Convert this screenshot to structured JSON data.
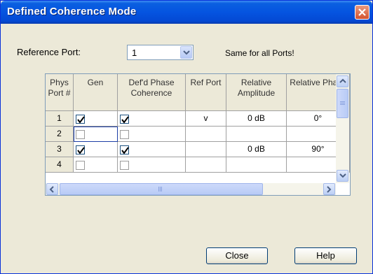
{
  "dialog": {
    "title": "Defined Coherence Mode",
    "reference_port_label": "Reference Port:",
    "reference_port_value": "1",
    "same_for_all": "Same for all Ports!",
    "close_label": "Close",
    "help_label": "Help"
  },
  "table": {
    "headers": {
      "phys_port": "Phys Port #",
      "gen": "Gen",
      "defd_phase": "Def'd Phase Coherence",
      "ref_port": "Ref Port",
      "rel_amp": "Relative Amplitude",
      "rel_phase": "Relative Phase"
    },
    "rows": [
      {
        "port": "1",
        "gen": true,
        "defd": true,
        "ref": "v",
        "amp": "0 dB",
        "phase": "0°"
      },
      {
        "port": "2",
        "gen": false,
        "defd": false,
        "ref": "",
        "amp": "",
        "phase": ""
      },
      {
        "port": "3",
        "gen": true,
        "defd": true,
        "ref": "",
        "amp": "0 dB",
        "phase": "90°"
      },
      {
        "port": "4",
        "gen": false,
        "defd": false,
        "ref": "",
        "amp": "",
        "phase": ""
      }
    ]
  },
  "colors": {
    "title_bar": "#0554e0",
    "dialog_bg": "#ece9d8",
    "close_button": "#d4532f"
  }
}
